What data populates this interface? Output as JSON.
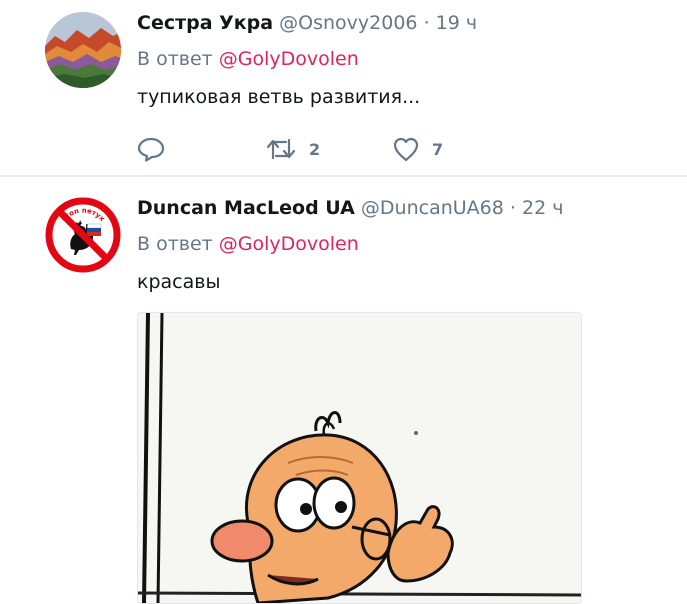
{
  "tweets": [
    {
      "name": "Сестра Укра",
      "handle": "@Osnovy2006",
      "separator": "·",
      "time": "19 ч",
      "reply_prefix": "В ответ",
      "reply_to": "@GolyDovolen",
      "text": "тупиковая ветвь развития...",
      "retweet_count": "2",
      "like_count": "7"
    },
    {
      "name": "Duncan MacLeod UA",
      "handle": "@DuncanUA68",
      "separator": "·",
      "time": "22 ч",
      "reply_prefix": "В ответ",
      "reply_to": "@GolyDovolen",
      "text": "красавы",
      "avatar_text": "стоп петух"
    }
  ],
  "icons": {
    "reply": "speech-bubble-icon",
    "retweet": "retweet-icon",
    "like": "heart-icon"
  },
  "colors": {
    "mention": "#e0245e",
    "secondary_text": "#657786",
    "divider": "#e6ecf0",
    "stop_sign": "#e30613"
  }
}
